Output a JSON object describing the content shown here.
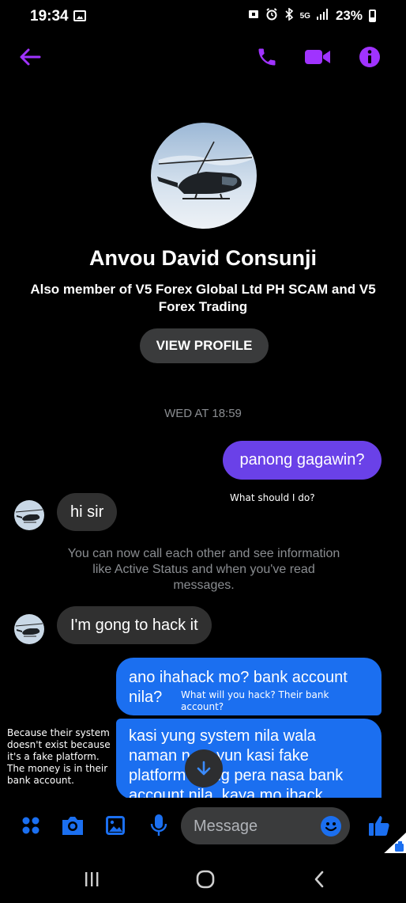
{
  "status_bar": {
    "time": "19:34",
    "network": "5G",
    "battery": "23%"
  },
  "header": {
    "back_icon": "back-arrow-icon",
    "call_icon": "phone-icon",
    "video_icon": "video-camera-icon",
    "info_icon": "info-icon",
    "accent_color": "#a033ff"
  },
  "profile": {
    "name": "Anvou David Consunji",
    "bio_line1": "Also member of V5 Forex Global Ltd PH SCAM and V5",
    "bio_line2": "Forex Trading",
    "view_profile_label": "VIEW PROFILE"
  },
  "conversation": {
    "timestamp": "WED AT 18:59",
    "messages": [
      {
        "direction": "outgoing",
        "text": "panong gagawin?",
        "color": "#6a41e8"
      },
      {
        "direction": "incoming",
        "text": "hi sir"
      },
      {
        "direction": "incoming",
        "text": "I'm gong to hack it"
      },
      {
        "direction": "outgoing",
        "line1": "ano ihahack mo? bank account",
        "line2": "nila?",
        "color": "#1b6ff0"
      },
      {
        "direction": "outgoing",
        "line1": "kasi yung system nila wala",
        "line2": "naman n      yun kasi fake",
        "line3": "platform      ng pera nasa bank",
        "line4": "account nila, kaya mo ihack",
        "color": "#1b6ff0"
      }
    ],
    "system_note_line1": "You can now call each other and see information",
    "system_note_line2": "like Active Status and when you've read",
    "system_note_line3": "messages."
  },
  "annotations": {
    "a1": "What should I do?",
    "a2_line1": "What will you hack? Their bank",
    "a2_line2": "account?",
    "a3_line1": "Because their system",
    "a3_line2": "doesn't exist because",
    "a3_line3": "it's a fake platform.",
    "a3_line4": "The money is in their",
    "a3_line5": "bank account."
  },
  "composer": {
    "placeholder": "Message",
    "icons": [
      "menu-dots-icon",
      "camera-icon",
      "gallery-icon",
      "microphone-icon",
      "emoji-icon",
      "thumbs-up-icon"
    ],
    "icon_color": "#1b6ff0"
  },
  "nav": {
    "icons": [
      "recent-apps-icon",
      "home-icon",
      "back-icon"
    ]
  }
}
